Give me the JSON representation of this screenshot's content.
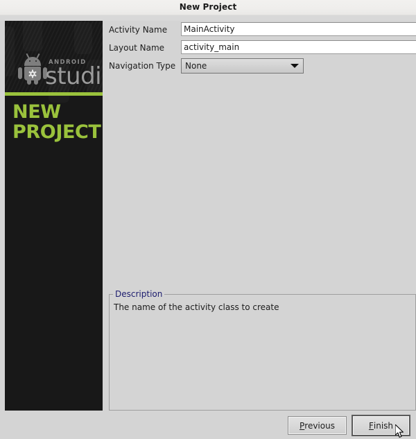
{
  "window": {
    "title": "New Project"
  },
  "sidebar": {
    "logo_top": "ANDROID",
    "logo_main": "studio",
    "robot_icon": "android-robot-icon",
    "gear_icon": "gear-icon",
    "heading_line1": "NEW",
    "heading_line2": "PROJECT",
    "accent_color": "#9ac23c",
    "background_color": "#181818",
    "logo_color": "#9b9b9b"
  },
  "form": {
    "fields": [
      {
        "label": "Activity Name",
        "value": "MainActivity",
        "type": "text",
        "placeholder": ""
      },
      {
        "label": "Layout Name",
        "value": "activity_main",
        "type": "text",
        "placeholder": ""
      },
      {
        "label": "Navigation Type",
        "value": "None",
        "type": "combobox",
        "dropdown_icon": "chevron-down-icon"
      }
    ]
  },
  "description": {
    "legend": "Description",
    "legend_color": "#1c1c6e",
    "text": "The name of the activity class to create"
  },
  "buttons": {
    "previous": {
      "mnemonic": "P",
      "rest": "revious",
      "focused": false
    },
    "finish": {
      "mnemonic": "F",
      "rest": "inish",
      "focused": true
    }
  },
  "cursor": {
    "icon": "mouse-pointer-icon"
  },
  "theme": {
    "dialog_background": "#d4d4d4",
    "titlebar_background": "#efeeec",
    "field_background": "#ffffff",
    "border_color": "#9b9b9b"
  }
}
